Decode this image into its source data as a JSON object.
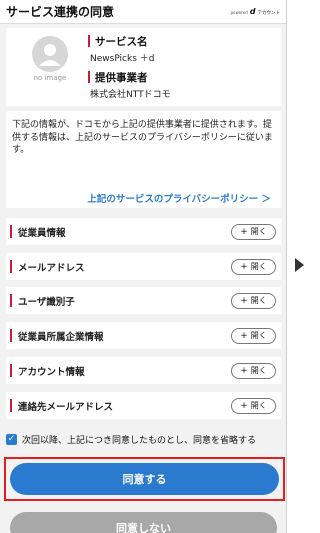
{
  "header": {
    "title": "サービス連携の同意",
    "brand_prefix": "powered",
    "brand_d": "d",
    "brand_text": "アカウント"
  },
  "service": {
    "no_image_label": "no image",
    "service_name_label": "サービス名",
    "service_name_value": "NewsPicks ＋d",
    "provider_label": "提供事業者",
    "provider_value": "株式会社NTTドコモ"
  },
  "consent": {
    "text": "下記の情報が、ドコモから上記の提供事業者に提供されます。提供する情報は、上記のサービスのプライバシーポリシーに従います。",
    "policy_link": "上記のサービスのプライバシーポリシー ＞"
  },
  "items": [
    {
      "label": "従業員情報",
      "button": "開く"
    },
    {
      "label": "メールアドレス",
      "button": "開く"
    },
    {
      "label": "ユーザ識別子",
      "button": "開く"
    },
    {
      "label": "従業員所属企業情報",
      "button": "開く"
    },
    {
      "label": "アカウント情報",
      "button": "開く"
    },
    {
      "label": "連絡先メールアドレス",
      "button": "開く"
    }
  ],
  "checkbox": {
    "checked": true,
    "label": "次回以降、上記につき同意したものとし、同意を省略する"
  },
  "buttons": {
    "agree": "同意する",
    "disagree": "同意しない"
  },
  "colors": {
    "accent_blue": "#2a7bd0",
    "accent_red": "#c81e3c",
    "highlight_frame": "#e02020",
    "disabled_gray": "#a8a8a8"
  }
}
